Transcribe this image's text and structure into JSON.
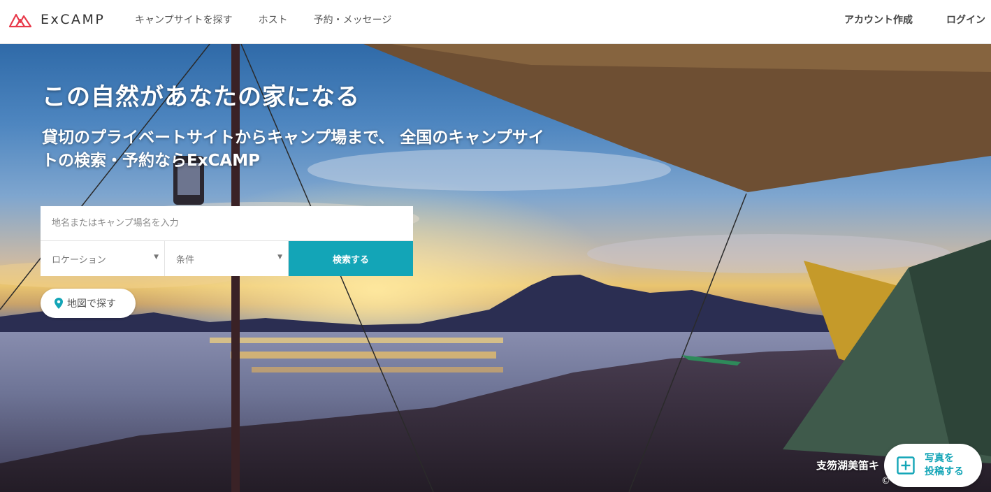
{
  "header": {
    "logo_text": "ExCAMP",
    "logo_icon": "excamp-logo-icon",
    "nav": [
      {
        "label": "キャンプサイトを探す"
      },
      {
        "label": "ホスト"
      },
      {
        "label": "予約・メッセージ"
      }
    ],
    "right": [
      {
        "label": "アカウント作成"
      },
      {
        "label": "ログイン"
      }
    ]
  },
  "hero": {
    "title": "この自然があなたの家になる",
    "subtitle_line1": "貸切のプライベートサイトからキャンプ場まで、 全国のキャンプサイ",
    "subtitle_line2": "トの検索・予約ならExCAMP",
    "search": {
      "placeholder": "地名またはキャンプ場名を入力",
      "location_label": "ロケーション",
      "condition_label": "条件",
      "button_label": "検索する"
    },
    "map_button_label": "地図で探す",
    "photo_caption": "支笏湖美笛キ",
    "photo_credit": "© Y... ... ...a",
    "post_button": {
      "line1": "写真を",
      "line2": "投稿する"
    }
  },
  "colors": {
    "accent": "#13a5b7",
    "logo": "#e8394a",
    "header_text": "#555555"
  }
}
